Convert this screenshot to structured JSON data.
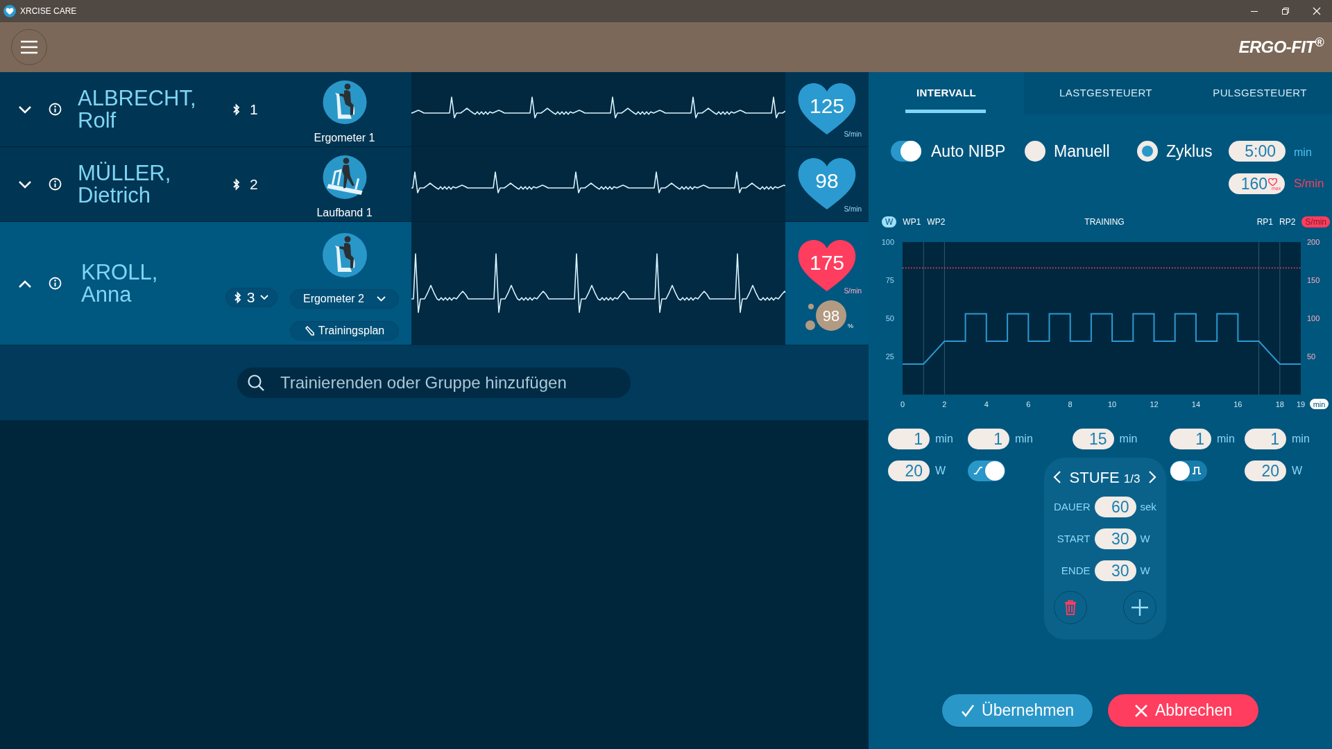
{
  "window": {
    "title": "XRCISE CARE"
  },
  "header": {
    "logo": "ERGO-FIT$^{®}$"
  },
  "trainees": [
    {
      "last_name": "ALBRECHT,",
      "first_name": "Rolf",
      "expanded": false,
      "channel": "1",
      "device": "Ergometer 1",
      "kind": "ergometer",
      "heart_rate": "125",
      "heart_unit": "S/min",
      "color": "#2a9ad0"
    },
    {
      "last_name": "MÜLLER,",
      "first_name": "Dietrich",
      "expanded": false,
      "channel": "2",
      "device": "Laufband 1",
      "kind": "treadmill",
      "heart_rate": "98",
      "heart_unit": "S/min",
      "color": "#2a9ad0"
    },
    {
      "last_name": "KROLL,",
      "first_name": "Anna",
      "expanded": true,
      "channel": "3",
      "device": "Ergometer 2",
      "kind": "ergometer",
      "plan_button": "Trainingsplan",
      "heart_rate": "175",
      "heart_unit": "S/min",
      "color": "#ff3d5e",
      "spo2": "98",
      "spo2_unit": "%"
    }
  ],
  "search": {
    "placeholder": "Trainierenden oder Gruppe hinzufügen"
  },
  "tabs": [
    {
      "label": "INTERVALL",
      "selected": true
    },
    {
      "label": "LASTGESTEUERT",
      "selected": false
    },
    {
      "label": "PULSGESTEUERT",
      "selected": false
    }
  ],
  "nibp": {
    "auto": {
      "label": "Auto NIBP",
      "on": true
    },
    "modes": [
      {
        "label": "Manuell",
        "selected": false
      },
      {
        "label": "Zyklus",
        "selected": true
      }
    ],
    "interval": {
      "value": "5:00",
      "unit": "min"
    },
    "max_hr": {
      "value": "160",
      "mark": "max",
      "unit": "S/min"
    }
  },
  "chart_header": {
    "phases_left": [
      "WP1",
      "WP2"
    ],
    "title": "TRAINING",
    "phases_right": [
      "RP1",
      "RP2"
    ],
    "x_unit": "min"
  },
  "chart_data": {
    "type": "line",
    "x": [
      0,
      1,
      2,
      3,
      3,
      4,
      4,
      5,
      5,
      6,
      6,
      7,
      7,
      8,
      8,
      9,
      9,
      10,
      10,
      11,
      11,
      12,
      12,
      13,
      13,
      14,
      14,
      15,
      15,
      16,
      16,
      17,
      18,
      19
    ],
    "series": [
      {
        "name": "W",
        "color": "#2a9ad0",
        "values": [
          20,
          20,
          35,
          35,
          53,
          53,
          35,
          35,
          53,
          53,
          35,
          35,
          53,
          53,
          35,
          35,
          53,
          53,
          35,
          35,
          53,
          53,
          35,
          35,
          53,
          53,
          35,
          35,
          53,
          53,
          35,
          35,
          20,
          20
        ]
      },
      {
        "name": "S/min",
        "color": "#ff3d5e",
        "line_style": "dotted",
        "values": [
          83,
          83,
          83,
          83,
          83,
          83,
          83,
          83,
          83,
          83,
          83,
          83,
          83,
          83,
          83,
          83,
          83,
          83,
          83,
          83,
          83,
          83,
          83,
          83,
          83,
          83,
          83,
          83,
          83,
          83,
          83,
          83,
          83,
          83
        ]
      }
    ],
    "xlim": [
      0,
      19
    ],
    "ylim": [
      0,
      100
    ],
    "xticks": [
      0,
      2,
      4,
      6,
      8,
      10,
      12,
      14,
      16,
      18,
      19
    ],
    "yticks": [
      25,
      50,
      75,
      100
    ],
    "y2lim": [
      0,
      200
    ],
    "y2ticks": [
      50,
      100,
      150,
      200
    ]
  },
  "phases": [
    {
      "kind": "load",
      "duration": "1",
      "duration_unit": "min",
      "load": "20",
      "load_unit": "W"
    },
    {
      "kind": "ramp",
      "duration": "1",
      "duration_unit": "min",
      "on": true
    },
    {
      "kind": "stage",
      "duration": "15",
      "duration_unit": "min"
    },
    {
      "kind": "pulse",
      "duration": "1",
      "duration_unit": "min",
      "on": false
    },
    {
      "kind": "load",
      "duration": "1",
      "duration_unit": "min",
      "load": "20",
      "load_unit": "W"
    }
  ],
  "stage": {
    "title": "STUFE",
    "index": "1/3",
    "fields": [
      {
        "label": "DAUER",
        "value": "60",
        "unit": "sek"
      },
      {
        "label": "START",
        "value": "30",
        "unit": "W"
      },
      {
        "label": "ENDE",
        "value": "30",
        "unit": "W"
      }
    ]
  },
  "buttons": [
    {
      "kind": "confirm",
      "label": "Übernehmen"
    },
    {
      "kind": "cancel",
      "label": "Abbrechen"
    }
  ]
}
